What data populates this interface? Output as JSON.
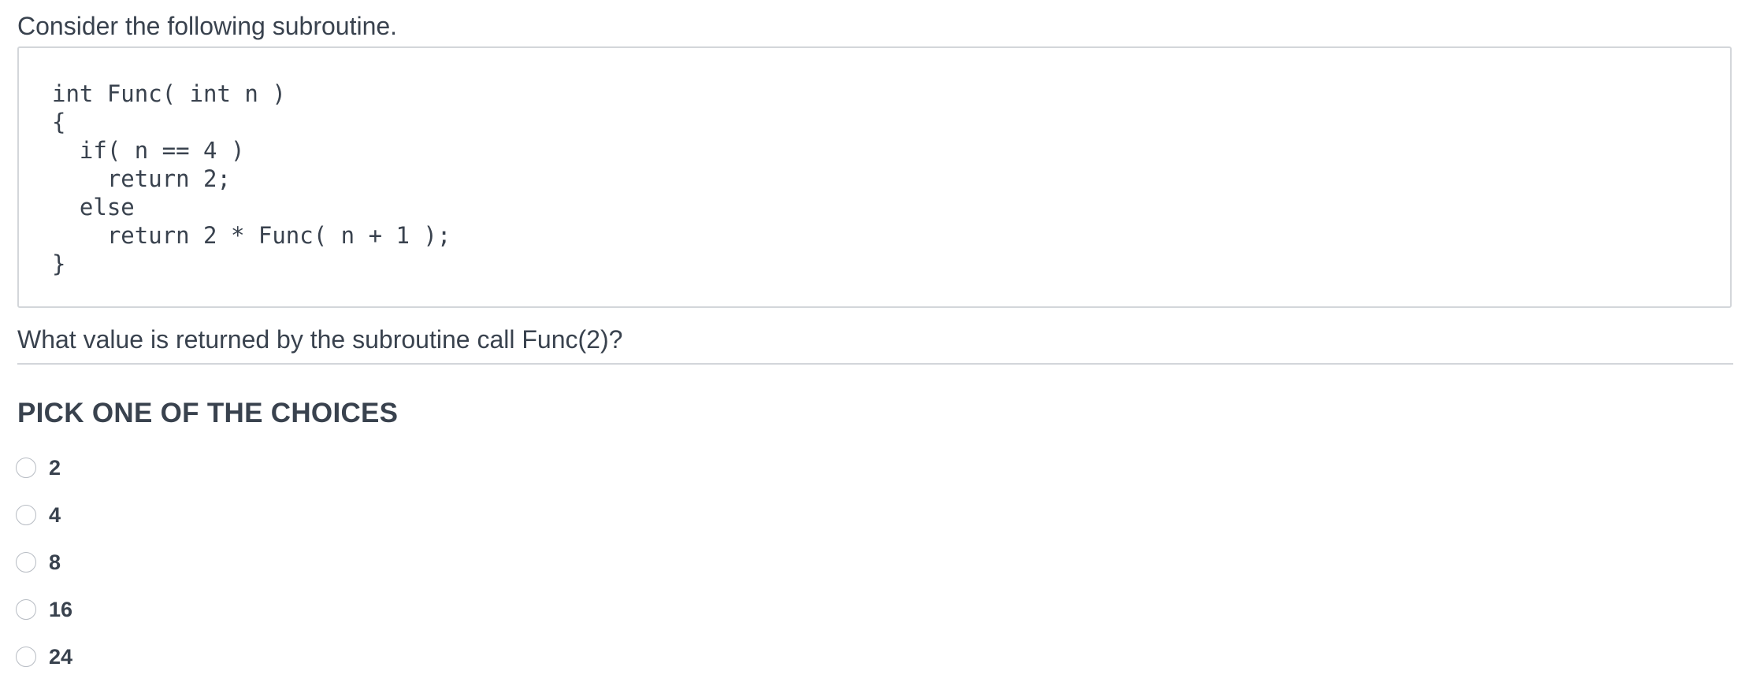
{
  "question": {
    "intro": "Consider the following subroutine.",
    "code_lines": [
      "int Func( int n )",
      "{",
      "  if( n == 4 )",
      "    return 2;",
      "  else",
      "    return 2 * Func( n + 1 );",
      "}"
    ],
    "prompt": "What value is returned by the subroutine call Func(2)?"
  },
  "choices_section": {
    "heading": "PICK ONE OF THE CHOICES",
    "options": [
      {
        "label": "2",
        "selected": false
      },
      {
        "label": "4",
        "selected": false
      },
      {
        "label": "8",
        "selected": false
      },
      {
        "label": "16",
        "selected": false
      },
      {
        "label": "24",
        "selected": false
      }
    ]
  }
}
